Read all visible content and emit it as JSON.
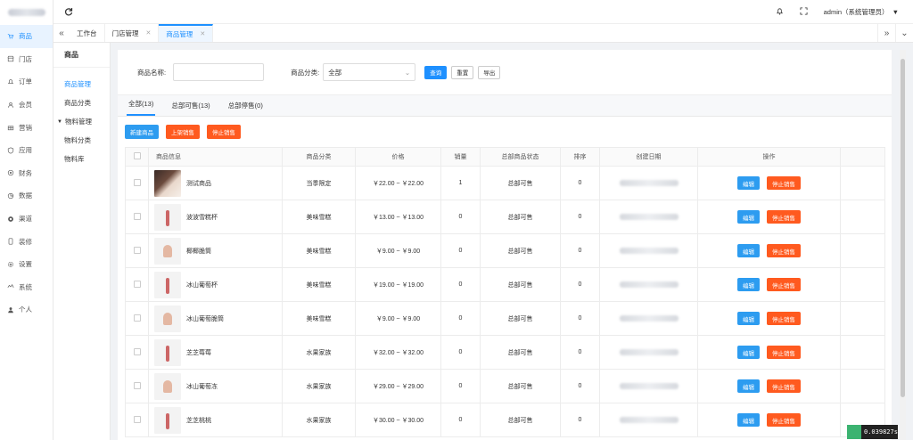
{
  "sidebar": {
    "items": [
      {
        "label": "商品",
        "icon": "cart-icon"
      },
      {
        "label": "门店",
        "icon": "shop-icon"
      },
      {
        "label": "订单",
        "icon": "bell-icon"
      },
      {
        "label": "会员",
        "icon": "user-icon"
      },
      {
        "label": "营销",
        "icon": "gift-icon"
      },
      {
        "label": "应用",
        "icon": "shield-icon"
      },
      {
        "label": "财务",
        "icon": "coin-icon"
      },
      {
        "label": "数据",
        "icon": "chart-icon"
      },
      {
        "label": "渠道",
        "icon": "channel-icon"
      },
      {
        "label": "装修",
        "icon": "phone-icon"
      },
      {
        "label": "设置",
        "icon": "gear-icon"
      },
      {
        "label": "系统",
        "icon": "system-icon"
      },
      {
        "label": "个人",
        "icon": "person-icon"
      }
    ]
  },
  "header": {
    "user_label": "admin（系统管理员）"
  },
  "tabs": [
    {
      "label": "工作台"
    },
    {
      "label": "门店管理"
    },
    {
      "label": "商品管理"
    }
  ],
  "submenu": {
    "title": "商品",
    "items": [
      "商品管理",
      "商品分类",
      "物料管理",
      "物料分类",
      "物料库"
    ]
  },
  "filters": {
    "name_label": "商品名称:",
    "category_label": "商品分类:",
    "category_value": "全部",
    "query_label": "查询",
    "reset_label": "重置",
    "export_label": "导出"
  },
  "page_tabs": [
    "全部(13)",
    "总部可售(13)",
    "总部停售(0)"
  ],
  "actions": {
    "create_label": "新建商品",
    "onsale_label": "上架销售",
    "stop_label": "停止销售"
  },
  "table": {
    "columns": [
      "商品信息",
      "商品分类",
      "价格",
      "销量",
      "总部商品状态",
      "排序",
      "创建日期",
      "操作"
    ],
    "edit_label": "编辑",
    "stop_label": "停止销售",
    "rows": [
      {
        "name": "测试商品",
        "category": "当季限定",
        "price": "￥22.00 ~ ￥22.00",
        "sales": "1",
        "status": "总部可售",
        "sort": "0"
      },
      {
        "name": "波波雪糕杯",
        "category": "美味雪糕",
        "price": "￥13.00 ~ ￥13.00",
        "sales": "0",
        "status": "总部可售",
        "sort": "0"
      },
      {
        "name": "椰椰脆筒",
        "category": "美味雪糕",
        "price": "￥9.00 ~ ￥9.00",
        "sales": "0",
        "status": "总部可售",
        "sort": "0"
      },
      {
        "name": "冰山葡萄杯",
        "category": "美味雪糕",
        "price": "￥19.00 ~ ￥19.00",
        "sales": "0",
        "status": "总部可售",
        "sort": "0"
      },
      {
        "name": "冰山葡萄脆筒",
        "category": "美味雪糕",
        "price": "￥9.00 ~ ￥9.00",
        "sales": "0",
        "status": "总部可售",
        "sort": "0"
      },
      {
        "name": "芝芝莓莓",
        "category": "水果家族",
        "price": "￥32.00 ~ ￥32.00",
        "sales": "0",
        "status": "总部可售",
        "sort": "0"
      },
      {
        "name": "冰山葡萄冻",
        "category": "水果家族",
        "price": "￥29.00 ~ ￥29.00",
        "sales": "0",
        "status": "总部可售",
        "sort": "0"
      },
      {
        "name": "芝芝桃桃",
        "category": "水果家族",
        "price": "￥30.00 ~ ￥30.00",
        "sales": "0",
        "status": "总部可售",
        "sort": "0"
      }
    ]
  },
  "perf_readout": "0.039827s",
  "colors": {
    "accent": "#1e90ff",
    "danger": "#ff5a1f"
  }
}
